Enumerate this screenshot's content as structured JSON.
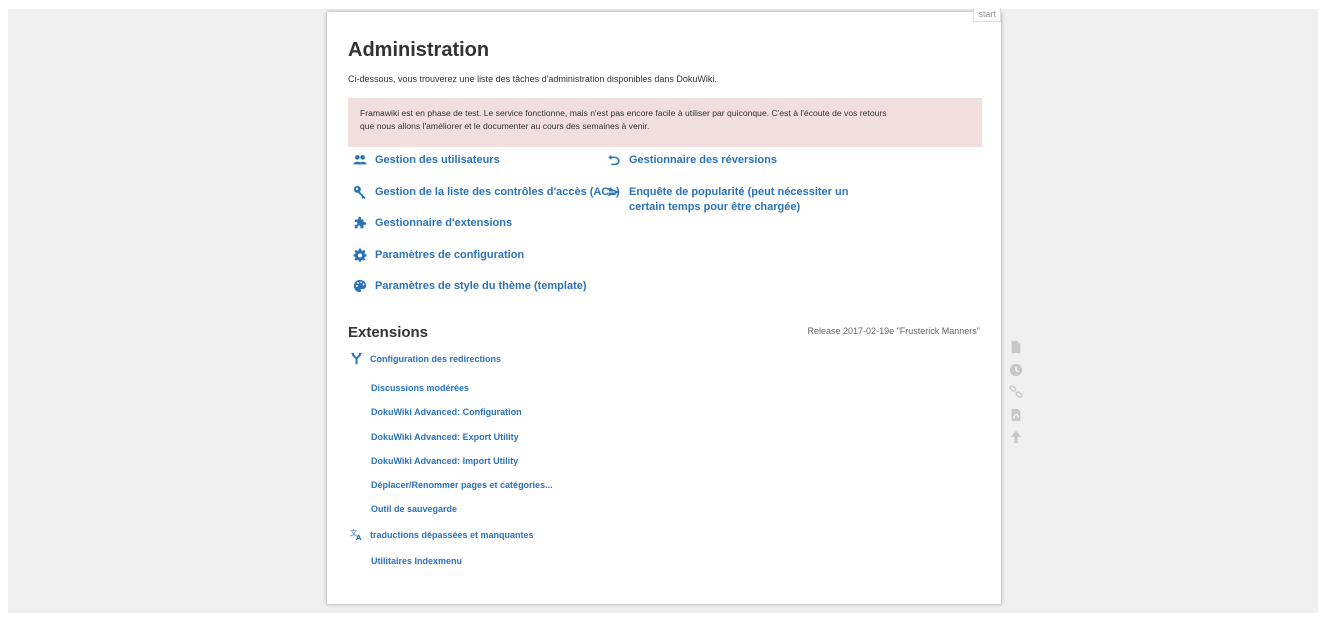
{
  "page": {
    "id_label": "start",
    "title": "Administration",
    "intro": "Ci-dessous, vous trouverez une liste des tâches d'administration disponibles dans DokuWiki.",
    "notice_line1": "Framawiki est en phase de test. Le service fonctionne, mais n'est pas encore facile à utiliser par quiconque. C'est à l'écoute de vos retours",
    "notice_line2": "que nous allons l'améliorer et le documenter au cours des semaines à venir."
  },
  "admin": {
    "users": "Gestion des utilisateurs",
    "acl": "Gestion de la liste des contrôles d'accès (ACL)",
    "extensions": "Gestionnaire d'extensions",
    "config": "Paramètres de configuration",
    "style": "Paramètres de style du thème (template)",
    "revert": "Gestionnaire des réversions",
    "popularity_line1": "Enquête de popularité (peut nécessiter un",
    "popularity_line2": "certain temps pour être chargée)"
  },
  "extensions_section": {
    "heading": "Extensions",
    "release": "Release 2017-02-19e \"Frusterick Manners\"",
    "items": [
      "Configuration des redirections",
      "Discussions modérées",
      "DokuWiki Advanced: Configuration",
      "DokuWiki Advanced: Export Utility",
      "DokuWiki Advanced: Import Utility",
      "Déplacer/Renommer pages et catégories...",
      "Outil de sauvegarde",
      "traductions dépassées et manquantes",
      "Utilitaires Indexmenu"
    ]
  },
  "colors": {
    "link": "#2b73b7",
    "notice_bg": "#f1dede",
    "icon_grey": "#c8c8c8"
  },
  "page_tools_icons": [
    "page-icon",
    "history-icon",
    "backlinks-icon",
    "export-pdf-icon",
    "back-to-top-icon"
  ]
}
